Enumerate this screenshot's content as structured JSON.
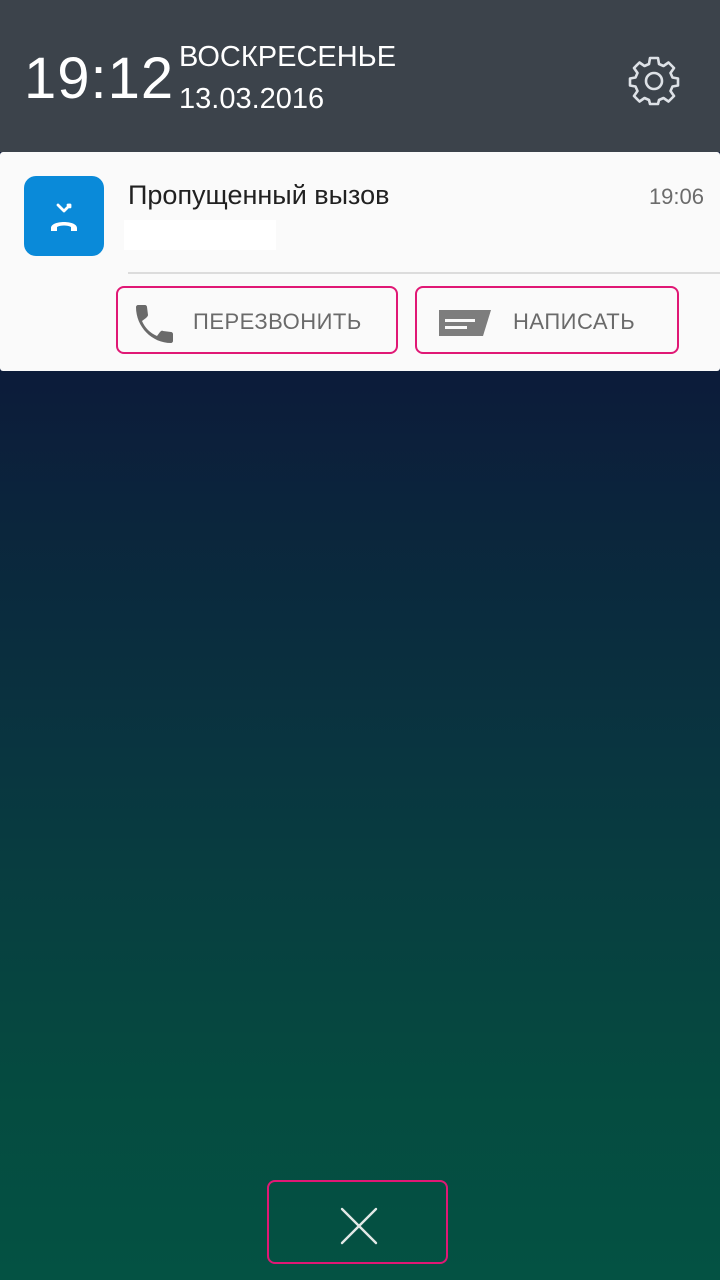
{
  "lockscreen": {
    "time": "19:12",
    "day": "ВОСКРЕСЕНЬЕ",
    "date": "13.03.2016",
    "settings_icon": "gear-icon"
  },
  "notification": {
    "app_icon": "missed-call-icon",
    "title": "Пропущенный вызов",
    "time": "19:06",
    "actions": [
      {
        "label": "ПЕРЕЗВОНИТЬ",
        "icon": "phone-icon"
      },
      {
        "label": "НАПИСАТЬ",
        "icon": "message-icon"
      }
    ]
  },
  "dismiss": {
    "icon": "close-icon"
  },
  "colors": {
    "header_bg": "#3c434b",
    "card_bg": "#fafafa",
    "app_icon_bg": "#0a8ad9",
    "highlight": "#e01875"
  }
}
